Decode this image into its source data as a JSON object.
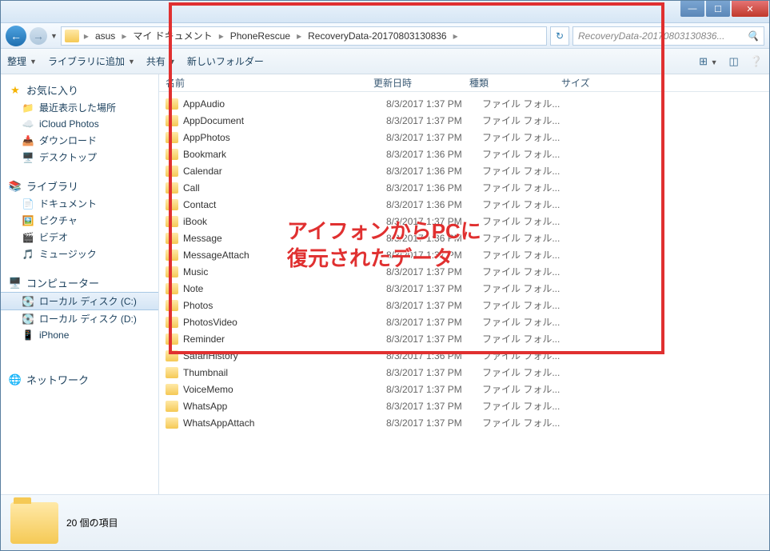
{
  "breadcrumb": [
    "asus",
    "マイ ドキュメント",
    "PhoneRescue",
    "RecoveryData-20170803130836"
  ],
  "search_placeholder": "RecoveryData-20170803130836...",
  "toolbar": {
    "organize": "整理",
    "add_library": "ライブラリに追加",
    "share": "共有",
    "new_folder": "新しいフォルダー"
  },
  "columns": {
    "name": "名前",
    "date": "更新日時",
    "type": "種類",
    "size": "サイズ"
  },
  "sidebar": {
    "favorites": {
      "label": "お気に入り",
      "items": [
        "最近表示した場所",
        "iCloud Photos",
        "ダウンロード",
        "デスクトップ"
      ]
    },
    "libraries": {
      "label": "ライブラリ",
      "items": [
        "ドキュメント",
        "ピクチャ",
        "ビデオ",
        "ミュージック"
      ]
    },
    "computer": {
      "label": "コンピューター",
      "items": [
        "ローカル ディスク (C:)",
        "ローカル ディスク (D:)",
        "iPhone"
      ]
    },
    "network": {
      "label": "ネットワーク"
    }
  },
  "file_type": "ファイル フォル...",
  "files": [
    {
      "name": "AppAudio",
      "date": "8/3/2017 1:37 PM"
    },
    {
      "name": "AppDocument",
      "date": "8/3/2017 1:37 PM"
    },
    {
      "name": "AppPhotos",
      "date": "8/3/2017 1:37 PM"
    },
    {
      "name": "Bookmark",
      "date": "8/3/2017 1:36 PM"
    },
    {
      "name": "Calendar",
      "date": "8/3/2017 1:36 PM"
    },
    {
      "name": "Call",
      "date": "8/3/2017 1:36 PM"
    },
    {
      "name": "Contact",
      "date": "8/3/2017 1:36 PM"
    },
    {
      "name": "iBook",
      "date": "8/3/2017 1:37 PM"
    },
    {
      "name": "Message",
      "date": "8/3/2017 1:36 PM"
    },
    {
      "name": "MessageAttach",
      "date": "8/3/2017 1:37 PM"
    },
    {
      "name": "Music",
      "date": "8/3/2017 1:37 PM"
    },
    {
      "name": "Note",
      "date": "8/3/2017 1:37 PM"
    },
    {
      "name": "Photos",
      "date": "8/3/2017 1:37 PM"
    },
    {
      "name": "PhotosVideo",
      "date": "8/3/2017 1:37 PM"
    },
    {
      "name": "Reminder",
      "date": "8/3/2017 1:37 PM"
    },
    {
      "name": "SafariHistory",
      "date": "8/3/2017 1:36 PM"
    },
    {
      "name": "Thumbnail",
      "date": "8/3/2017 1:37 PM"
    },
    {
      "name": "VoiceMemo",
      "date": "8/3/2017 1:37 PM"
    },
    {
      "name": "WhatsApp",
      "date": "8/3/2017 1:37 PM"
    },
    {
      "name": "WhatsAppAttach",
      "date": "8/3/2017 1:37 PM"
    }
  ],
  "status": "20 個の項目",
  "annotation": {
    "line1": "アイフォンからPCに",
    "line2": "復元されたデータ"
  }
}
